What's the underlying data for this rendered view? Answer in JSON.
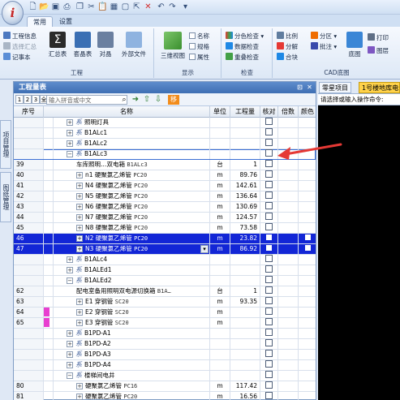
{
  "app": {
    "logo_text": "i"
  },
  "tabs": [
    {
      "label": "常用"
    },
    {
      "label": "设置"
    }
  ],
  "ribbon": {
    "groups": {
      "engineering": {
        "label": "工程",
        "items": [
          "工程信息",
          "选择汇总",
          "记事本"
        ],
        "big": [
          "汇总表",
          "套晶表",
          "对晶",
          "外部文件"
        ]
      },
      "display": {
        "label": "显示",
        "big": [
          "三维视图"
        ],
        "checks": [
          "名称",
          "规格",
          "属性"
        ]
      },
      "check": {
        "label": "检查",
        "items": [
          "分色检查",
          "数据检查",
          "重叠检查"
        ]
      },
      "cad": {
        "label": "CAD底图",
        "items": [
          "比例",
          "分解",
          "合块",
          "分区",
          "批注"
        ],
        "big": [
          "底图"
        ],
        "right": [
          "打印",
          "图层"
        ]
      }
    }
  },
  "sidetabs": [
    "项目管理",
    "图纸管理"
  ],
  "panel": {
    "title": "工程量表",
    "levels": [
      "1",
      "2",
      "3",
      "全"
    ],
    "search_placeholder": "输入拼音或中文",
    "move_label": "移",
    "columns": {
      "no": "序号",
      "name": "名称",
      "unit": "单位",
      "qty": "工程量",
      "check": "核对",
      "mult": "倍数",
      "color": "颜色"
    }
  },
  "rows": [
    {
      "no": "",
      "level": 2,
      "exp": "+",
      "icon": "系",
      "name": "照明灯具",
      "spec": "",
      "unit": "",
      "qty": ""
    },
    {
      "no": "",
      "level": 2,
      "exp": "+",
      "icon": "系",
      "name": "B1ALc1",
      "spec": "",
      "unit": "",
      "qty": ""
    },
    {
      "no": "",
      "level": 2,
      "exp": "+",
      "icon": "系",
      "name": "B1ALc2",
      "spec": "",
      "unit": "",
      "qty": ""
    },
    {
      "no": "",
      "level": 2,
      "exp": "−",
      "icon": "系",
      "name": "B1ALc3",
      "spec": "",
      "unit": "",
      "qty": "",
      "focus": true
    },
    {
      "no": "39",
      "level": 3,
      "exp": "",
      "icon": "",
      "name": "车库照明…双电箱",
      "spec": "B1ALc3",
      "unit": "台",
      "qty": "1"
    },
    {
      "no": "40",
      "level": 3,
      "exp": "+",
      "icon": "",
      "name": "n1 硬聚氯乙烯管",
      "spec": "PC20",
      "unit": "m",
      "qty": "89.76"
    },
    {
      "no": "41",
      "level": 3,
      "exp": "+",
      "icon": "",
      "name": "N4 硬聚氯乙烯管",
      "spec": "PC20",
      "unit": "m",
      "qty": "142.61"
    },
    {
      "no": "42",
      "level": 3,
      "exp": "+",
      "icon": "",
      "name": "N5 硬聚氯乙烯管",
      "spec": "PC20",
      "unit": "m",
      "qty": "136.64"
    },
    {
      "no": "43",
      "level": 3,
      "exp": "+",
      "icon": "",
      "name": "N6 硬聚氯乙烯管",
      "spec": "PC20",
      "unit": "m",
      "qty": "130.69"
    },
    {
      "no": "44",
      "level": 3,
      "exp": "+",
      "icon": "",
      "name": "N7 硬聚氯乙烯管",
      "spec": "PC20",
      "unit": "m",
      "qty": "124.57"
    },
    {
      "no": "45",
      "level": 3,
      "exp": "+",
      "icon": "",
      "name": "N8 硬聚氯乙烯管",
      "spec": "PC20",
      "unit": "m",
      "qty": "73.58"
    },
    {
      "no": "46",
      "level": 3,
      "exp": "+",
      "icon": "",
      "name": "N2 硬聚氯乙烯管",
      "spec": "PC20",
      "unit": "m",
      "qty": "23.82",
      "selected": true
    },
    {
      "no": "47",
      "level": 3,
      "exp": "+",
      "icon": "",
      "name": "N3 硬聚氯乙烯管",
      "spec": "PC20",
      "unit": "m",
      "qty": "86.92",
      "selected": true,
      "dropdown": true
    },
    {
      "no": "",
      "level": 2,
      "exp": "+",
      "icon": "系",
      "name": "B1ALc4",
      "spec": "",
      "unit": "",
      "qty": ""
    },
    {
      "no": "",
      "level": 2,
      "exp": "+",
      "icon": "系",
      "name": "B1ALEd1",
      "spec": "",
      "unit": "",
      "qty": ""
    },
    {
      "no": "",
      "level": 2,
      "exp": "−",
      "icon": "系",
      "name": "B1ALEd2",
      "spec": "",
      "unit": "",
      "qty": ""
    },
    {
      "no": "62",
      "level": 3,
      "exp": "",
      "icon": "",
      "name": "配电室备用照明双电源切换箱",
      "spec": "B1A…",
      "unit": "台",
      "qty": "1"
    },
    {
      "no": "63",
      "level": 3,
      "exp": "+",
      "icon": "",
      "name": "E1 穿钢管",
      "spec": "SC20",
      "unit": "m",
      "qty": "93.35"
    },
    {
      "no": "64",
      "level": 3,
      "exp": "+",
      "icon": "",
      "name": "E2 穿钢管",
      "spec": "SC20",
      "unit": "m",
      "qty": "",
      "pink": true
    },
    {
      "no": "65",
      "level": 3,
      "exp": "+",
      "icon": "",
      "name": "E3 穿钢管",
      "spec": "SC20",
      "unit": "m",
      "qty": "",
      "pink": true
    },
    {
      "no": "",
      "level": 2,
      "exp": "+",
      "icon": "系",
      "name": "B1PD-A1",
      "spec": "",
      "unit": "",
      "qty": ""
    },
    {
      "no": "",
      "level": 2,
      "exp": "+",
      "icon": "系",
      "name": "B1PD-A2",
      "spec": "",
      "unit": "",
      "qty": ""
    },
    {
      "no": "",
      "level": 2,
      "exp": "+",
      "icon": "系",
      "name": "B1PD-A3",
      "spec": "",
      "unit": "",
      "qty": ""
    },
    {
      "no": "",
      "level": 2,
      "exp": "+",
      "icon": "系",
      "name": "B1PD-A4",
      "spec": "",
      "unit": "",
      "qty": ""
    },
    {
      "no": "",
      "level": 2,
      "exp": "−",
      "icon": "系",
      "name": "楼梯间电井",
      "spec": "",
      "unit": "",
      "qty": ""
    },
    {
      "no": "80",
      "level": 3,
      "exp": "+",
      "icon": "",
      "name": "硬聚氯乙烯管",
      "spec": "PC16",
      "unit": "m",
      "qty": "117.42"
    },
    {
      "no": "81",
      "level": 3,
      "exp": "+",
      "icon": "",
      "name": "硬聚氯乙烯管",
      "spec": "PC20",
      "unit": "m",
      "qty": "16.56"
    }
  ],
  "right_panel": {
    "tab1": "零星项目",
    "tab2": "1号楼地库电气",
    "command": "请选择或输入操作命令:"
  },
  "colors": {
    "selection": "#1226d6",
    "accent_orange": "#f28c1c",
    "annotation_red": "#e53935",
    "pink": "#e83fd0"
  }
}
